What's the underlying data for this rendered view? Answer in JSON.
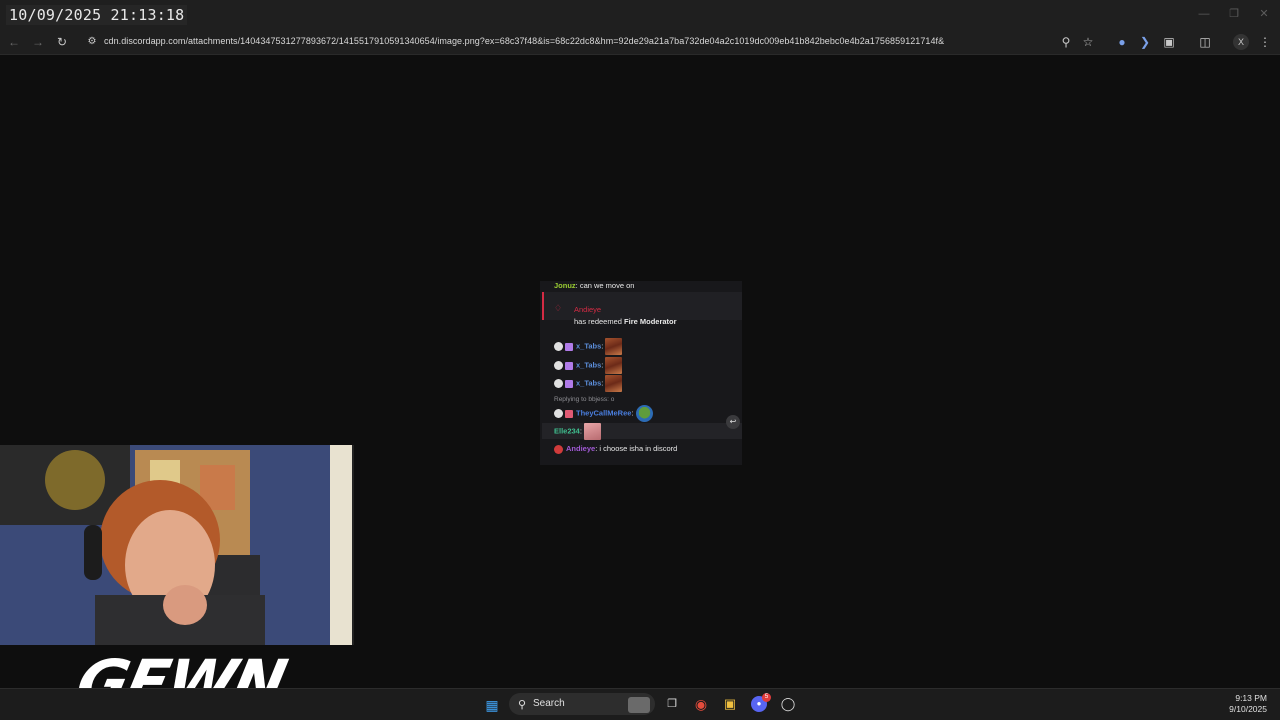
{
  "overlay": {
    "datetime": "10/09/2025 21:13:18"
  },
  "browser": {
    "url": "cdn.discordapp.com/attachments/1404347531277893672/1415517910591340654/image.png?ex=68c37f48&is=68c22dc8&hm=92de29a21a7ba732de04a2c1019dc009eb41b842bebc0e4b2a1756859121714f&"
  },
  "chat": {
    "line1": {
      "user": "Jonuz",
      "text": ": can we move on"
    },
    "redeem": {
      "user": "Andieye",
      "prefix": "has redeemed ",
      "reward": "Fire Moderator"
    },
    "tabs": [
      {
        "user": "x_Tabs",
        "sep": ":"
      },
      {
        "user": "x_Tabs",
        "sep": ":"
      },
      {
        "user": "x_Tabs",
        "sep": ":"
      }
    ],
    "reply_context": "Replying to bbjess: o",
    "reply_line": {
      "user": "TheyCallMeRee",
      "sep": ":"
    },
    "elle_line": {
      "user": "Elle234",
      "sep": ":"
    },
    "last_line": {
      "user": "Andieye",
      "text": ": i choose isha in discord"
    }
  },
  "stream": {
    "watermark": "GEWN"
  },
  "taskbar": {
    "search_label": "Search",
    "time": "9:13 PM",
    "date": "9/10/2025",
    "discord_badge": "5"
  },
  "colors": {
    "jonuz": "#9acd32",
    "andieye_redeem": "#d42b44",
    "tabs": "#5b8dd9",
    "theycallmeree": "#4a7fe0",
    "elle": "#3fbf8f",
    "andieye": "#a15ad6"
  }
}
